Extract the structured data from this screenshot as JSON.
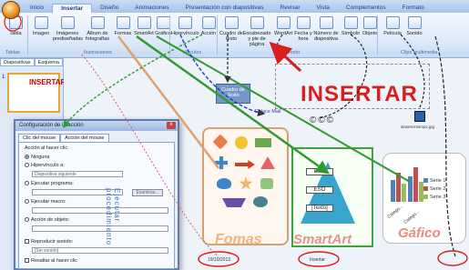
{
  "tabs": [
    "Inicio",
    "Insertar",
    "Diseño",
    "Animaciones",
    "Presentación con diapositivas",
    "Revisar",
    "Vista",
    "Complementos",
    "Formato"
  ],
  "active_tab": "Insertar",
  "ribbon": {
    "buttons": [
      "Tabla",
      "Imagen",
      "Imágenes prediseñadas",
      "Álbum de fotografías",
      "Formas",
      "SmartArt",
      "Gráfico",
      "Hipervínculo",
      "Acción",
      "Cuadro de texto",
      "Encabezado y pie de página",
      "WordArt",
      "Fecha y hora",
      "Número de diapositiva",
      "Símbolo",
      "Objeto",
      "Película",
      "Sonido"
    ],
    "groups": [
      "Tablas",
      "Ilustraciones",
      "Vínculos",
      "Texto",
      "Clips multimedia"
    ]
  },
  "left_pane": {
    "tabs": [
      "Diapositivas",
      "Esquema"
    ],
    "thumb_title": "INSERTAR",
    "thumb_number": "1"
  },
  "slide": {
    "title": "INSERTAR",
    "copyright": "©©©",
    "cuadro": "Cuadro de Texto",
    "enlace": "Enlace Mail",
    "picture_caption": "slasetcmnimpc.jpg",
    "formas_label": "Fomas",
    "smartart_label": "SmartArt",
    "grafico_label": "Gáfico",
    "pyramid": [
      "BTO",
      "ESO",
      "[Texto]"
    ],
    "legend": [
      "Serie 1",
      "Serie 2",
      "Serie 3"
    ],
    "chart_axis_labels": [
      "Catego...",
      "Catego..."
    ],
    "footer_date": "19/10/2013",
    "footer_text": "Insertar"
  },
  "dialog": {
    "title": "Configuración de la acción",
    "close": "x",
    "tabs": [
      "Clic del mouse",
      "Acción del mouse"
    ],
    "section": "Acción al hacer clic",
    "options": [
      "Ninguna",
      "Hipervínculo a:",
      "Ejecutar programa:",
      "Ejecutar macro:",
      "Acción de objeto:"
    ],
    "hyperlink_value": "Diapositiva siguiente",
    "browse_button": "Examinar...",
    "play_sound": "Reproducir sonido:",
    "sound_value": "[Sin sonido]",
    "highlight": "Resaltar al hacer clic",
    "vertical_text": "Ejecutar procedimiento"
  },
  "colors": {
    "insertar": "#d81e1e",
    "formas": "#f4b183",
    "smart": "#3ea33e",
    "series": [
      "#4f81bd",
      "#c0504d",
      "#9bbb59"
    ]
  }
}
